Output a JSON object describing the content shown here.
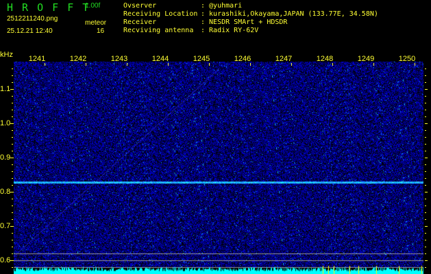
{
  "header": {
    "app_title": "H R O F F T",
    "version": "1.00f",
    "filename": "2512211240.png",
    "datetime": "25.12.21 12:40",
    "meteor_label": "meteor",
    "meteor_count": "16"
  },
  "info": [
    {
      "label": "Ovserver",
      "value": ": @yuhmari"
    },
    {
      "label": "Receiving Location",
      "value": ": kurashiki,Okayama,JAPAN (133.77E, 34.58N)"
    },
    {
      "label": "Receiver",
      "value": ": NESDR SMArt + HDSDR"
    },
    {
      "label": "Recviving antenna",
      "value": ": Radix RY-62V"
    }
  ],
  "axis": {
    "y_unit": "kHz",
    "y_labels": [
      "1.1",
      "1.0",
      "0.9",
      "0.8",
      "0.7",
      "0.6"
    ],
    "freq_labels": [
      "1241",
      "1242",
      "1243",
      "1244",
      "1245",
      "1246",
      "1247",
      "1248",
      "1249",
      "1250"
    ]
  },
  "colors": {
    "label": "#ffff33",
    "title": "#22dd22",
    "signal": "#00ffff",
    "background": "#000000"
  }
}
